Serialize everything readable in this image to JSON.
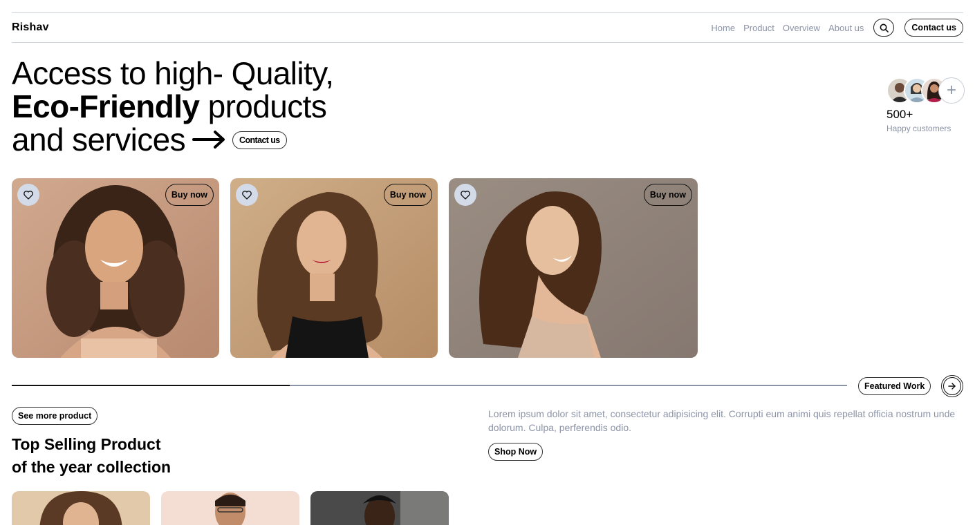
{
  "header": {
    "brand": "Rishav",
    "nav": [
      "Home",
      "Product",
      "Overview",
      "About us"
    ],
    "contact_label": "Contact us"
  },
  "hero": {
    "line1": "Access to high- Quality,",
    "line2_bold": "Eco-Friendly",
    "line2_rest": " products",
    "line3": "and services",
    "cta_label": "Contact us"
  },
  "customers": {
    "count": "500+",
    "label": "Happy customers",
    "plus": "+"
  },
  "products": [
    {
      "buy_label": "Buy now",
      "bg": "#c49a7f"
    },
    {
      "buy_label": "Buy now",
      "bg": "#c7a47e"
    },
    {
      "buy_label": "Buy now",
      "bg": "#8f8276"
    }
  ],
  "progress": {
    "fill_fraction": 0.333,
    "featured_label": "Featured Work"
  },
  "bottom": {
    "see_more_label": "See more product",
    "title_line1": "Top Selling Product",
    "title_line2": "of the year collection",
    "description": "Lorem ipsum dolor sit amet, consectetur adipisicing elit. Corrupti eum animi quis repellat officia nostrum unde dolorum. Culpa, perferendis odio.",
    "shop_label": "Shop Now"
  },
  "colors": {
    "muted": "#8b93a6",
    "divider": "#cfd4dc",
    "heart_bg": "#d3dbe8"
  }
}
